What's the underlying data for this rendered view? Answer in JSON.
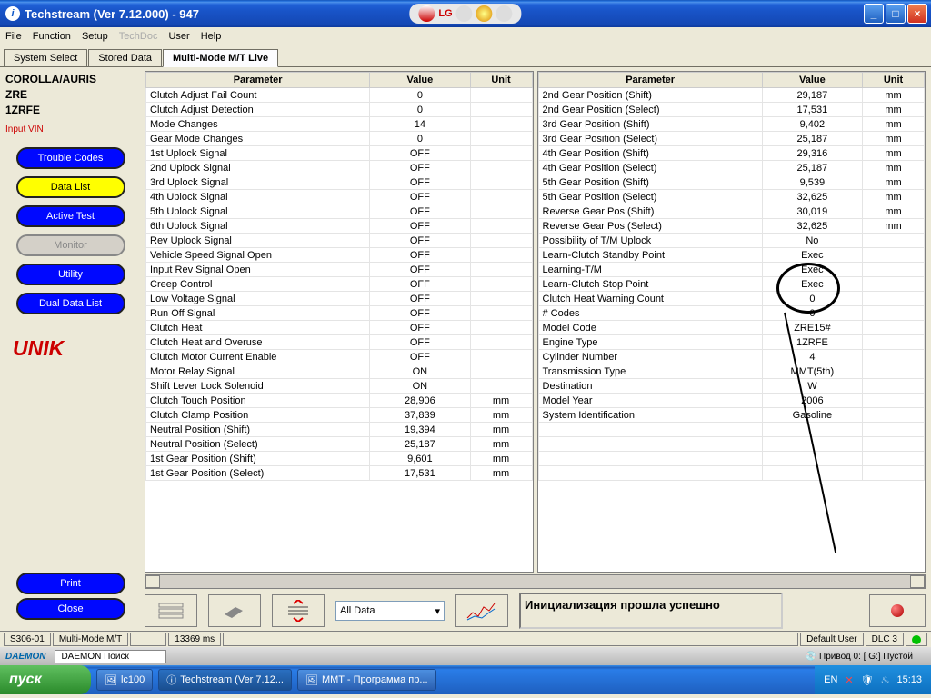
{
  "title": "Techstream (Ver 7.12.000) - 947",
  "menu": [
    "File",
    "Function",
    "Setup",
    "TechDoc",
    "User",
    "Help"
  ],
  "tabs": [
    "System Select",
    "Stored Data",
    "Multi-Mode M/T Live"
  ],
  "vehicle": {
    "l1": "COROLLA/AURIS",
    "l2": "ZRE",
    "l3": "1ZRFE"
  },
  "inputvin": "Input VIN",
  "sidebtns": {
    "trouble": "Trouble Codes",
    "datalist": "Data List",
    "active": "Active Test",
    "monitor": "Monitor",
    "utility": "Utility",
    "dual": "Dual Data List",
    "print": "Print",
    "close": "Close"
  },
  "unik": "UNIK",
  "headers": {
    "param": "Parameter",
    "value": "Value",
    "unit": "Unit"
  },
  "left": [
    {
      "p": "Clutch Adjust Fail Count",
      "v": "0",
      "u": ""
    },
    {
      "p": "Clutch Adjust Detection",
      "v": "0",
      "u": ""
    },
    {
      "p": "Mode Changes",
      "v": "14",
      "u": ""
    },
    {
      "p": "Gear Mode Changes",
      "v": "0",
      "u": ""
    },
    {
      "p": "1st Uplock Signal",
      "v": "OFF",
      "u": ""
    },
    {
      "p": "2nd Uplock Signal",
      "v": "OFF",
      "u": ""
    },
    {
      "p": "3rd Uplock Signal",
      "v": "OFF",
      "u": ""
    },
    {
      "p": "4th Uplock Signal",
      "v": "OFF",
      "u": ""
    },
    {
      "p": "5th Uplock Signal",
      "v": "OFF",
      "u": ""
    },
    {
      "p": "6th Uplock Signal",
      "v": "OFF",
      "u": ""
    },
    {
      "p": "Rev Uplock Signal",
      "v": "OFF",
      "u": ""
    },
    {
      "p": "Vehicle Speed Signal Open",
      "v": "OFF",
      "u": ""
    },
    {
      "p": "Input Rev Signal Open",
      "v": "OFF",
      "u": ""
    },
    {
      "p": "Creep Control",
      "v": "OFF",
      "u": ""
    },
    {
      "p": "Low Voltage Signal",
      "v": "OFF",
      "u": ""
    },
    {
      "p": "Run Off Signal",
      "v": "OFF",
      "u": ""
    },
    {
      "p": "Clutch Heat",
      "v": "OFF",
      "u": ""
    },
    {
      "p": "Clutch Heat and Overuse",
      "v": "OFF",
      "u": ""
    },
    {
      "p": "Clutch Motor Current Enable",
      "v": "OFF",
      "u": ""
    },
    {
      "p": "Motor Relay Signal",
      "v": "ON",
      "u": ""
    },
    {
      "p": "Shift Lever Lock Solenoid",
      "v": "ON",
      "u": ""
    },
    {
      "p": "Clutch Touch Position",
      "v": "28,906",
      "u": "mm"
    },
    {
      "p": "Clutch Clamp Position",
      "v": "37,839",
      "u": "mm"
    },
    {
      "p": "Neutral Position (Shift)",
      "v": "19,394",
      "u": "mm"
    },
    {
      "p": "Neutral Position (Select)",
      "v": "25,187",
      "u": "mm"
    },
    {
      "p": "1st Gear Position (Shift)",
      "v": "9,601",
      "u": "mm"
    },
    {
      "p": "1st Gear Position (Select)",
      "v": "17,531",
      "u": "mm"
    }
  ],
  "right": [
    {
      "p": "2nd Gear Position (Shift)",
      "v": "29,187",
      "u": "mm"
    },
    {
      "p": "2nd Gear Position (Select)",
      "v": "17,531",
      "u": "mm"
    },
    {
      "p": "3rd Gear Position (Shift)",
      "v": "9,402",
      "u": "mm"
    },
    {
      "p": "3rd Gear Position (Select)",
      "v": "25,187",
      "u": "mm"
    },
    {
      "p": "4th Gear Position (Shift)",
      "v": "29,316",
      "u": "mm"
    },
    {
      "p": "4th Gear Position (Select)",
      "v": "25,187",
      "u": "mm"
    },
    {
      "p": "5th Gear Position (Shift)",
      "v": "9,539",
      "u": "mm"
    },
    {
      "p": "5th Gear Position (Select)",
      "v": "32,625",
      "u": "mm"
    },
    {
      "p": "Reverse Gear Pos (Shift)",
      "v": "30,019",
      "u": "mm"
    },
    {
      "p": "Reverse Gear Pos (Select)",
      "v": "32,625",
      "u": "mm"
    },
    {
      "p": "Possibility of T/M Uplock",
      "v": "No",
      "u": ""
    },
    {
      "p": "Learn-Clutch Standby Point",
      "v": "Exec",
      "u": ""
    },
    {
      "p": "Learning-T/M",
      "v": "Exec",
      "u": ""
    },
    {
      "p": "Learn-Clutch Stop Point",
      "v": "Exec",
      "u": ""
    },
    {
      "p": "Clutch Heat Warning Count",
      "v": "0",
      "u": ""
    },
    {
      "p": "# Codes",
      "v": "0",
      "u": ""
    },
    {
      "p": "Model Code",
      "v": "ZRE15#",
      "u": ""
    },
    {
      "p": "Engine Type",
      "v": "1ZRFE",
      "u": ""
    },
    {
      "p": "Cylinder Number",
      "v": "4",
      "u": ""
    },
    {
      "p": "Transmission Type",
      "v": "MMT(5th)",
      "u": ""
    },
    {
      "p": "Destination",
      "v": "W",
      "u": ""
    },
    {
      "p": "Model Year",
      "v": "2006",
      "u": ""
    },
    {
      "p": "System Identification",
      "v": "Gasoline",
      "u": ""
    },
    {
      "p": "",
      "v": "",
      "u": ""
    },
    {
      "p": "",
      "v": "",
      "u": ""
    },
    {
      "p": "",
      "v": "",
      "u": ""
    },
    {
      "p": "",
      "v": "",
      "u": ""
    }
  ],
  "dropdown": "All Data",
  "message": "Инициализация прошла успешно",
  "status": {
    "s1": "S306-01",
    "s2": "Multi-Mode M/T",
    "s3": "13369 ms",
    "s4": "Default User",
    "s5": "DLC 3"
  },
  "daemon": {
    "brand": "DAEMON",
    "search": "DAEMON Поиск",
    "drive": "Привод 0: [ G:] Пустой"
  },
  "taskbar": {
    "start": "пуск",
    "t1": "lc100",
    "t2": "Techstream (Ver 7.12...",
    "t3": "MMT - Программа пр...",
    "lang": "EN",
    "time": "15:13"
  }
}
